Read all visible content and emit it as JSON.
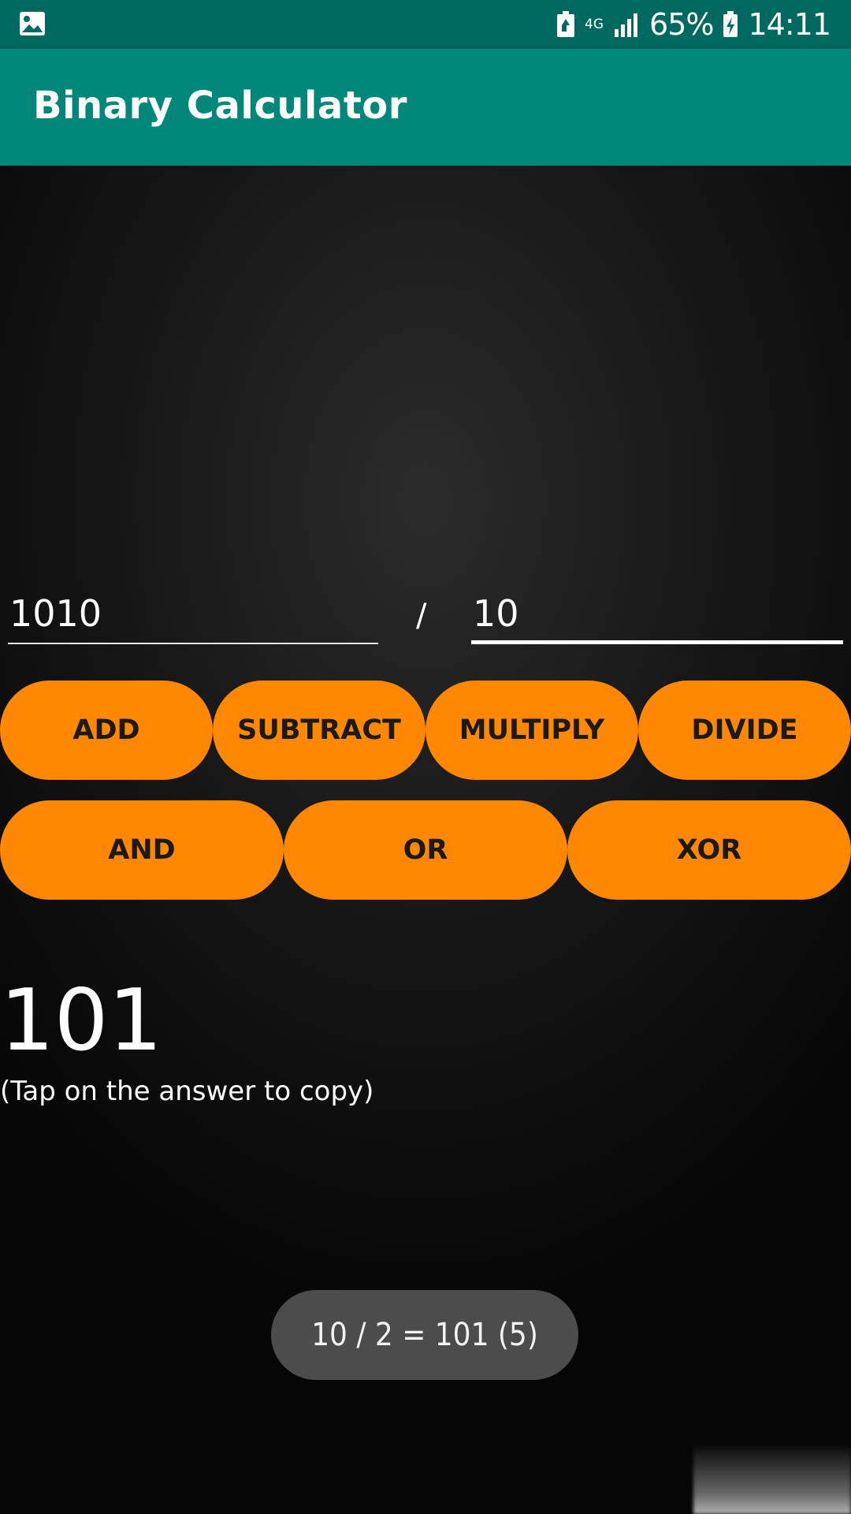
{
  "status_bar": {
    "network": "4G",
    "battery_percent": "65%",
    "time": "14:11",
    "icons": [
      "image-icon",
      "battery-saver-icon",
      "signal-icon",
      "battery-charging-icon"
    ]
  },
  "app_bar": {
    "title": "Binary Calculator"
  },
  "inputs": {
    "first_value": "1010",
    "operator": "/",
    "second_value": "10"
  },
  "operations": {
    "row1": [
      "ADD",
      "SUBTRACT",
      "MULTIPLY",
      "DIVIDE"
    ],
    "row2": [
      "AND",
      "OR",
      "XOR"
    ]
  },
  "result": {
    "value": "101",
    "hint": "(Tap on the answer to copy)"
  },
  "toast": {
    "message": "10 / 2 = 101 (5)"
  },
  "colors": {
    "status_bar": "#00695f",
    "app_bar": "#00877a",
    "button": "#ff8800",
    "toast": "#4c4c4c"
  }
}
